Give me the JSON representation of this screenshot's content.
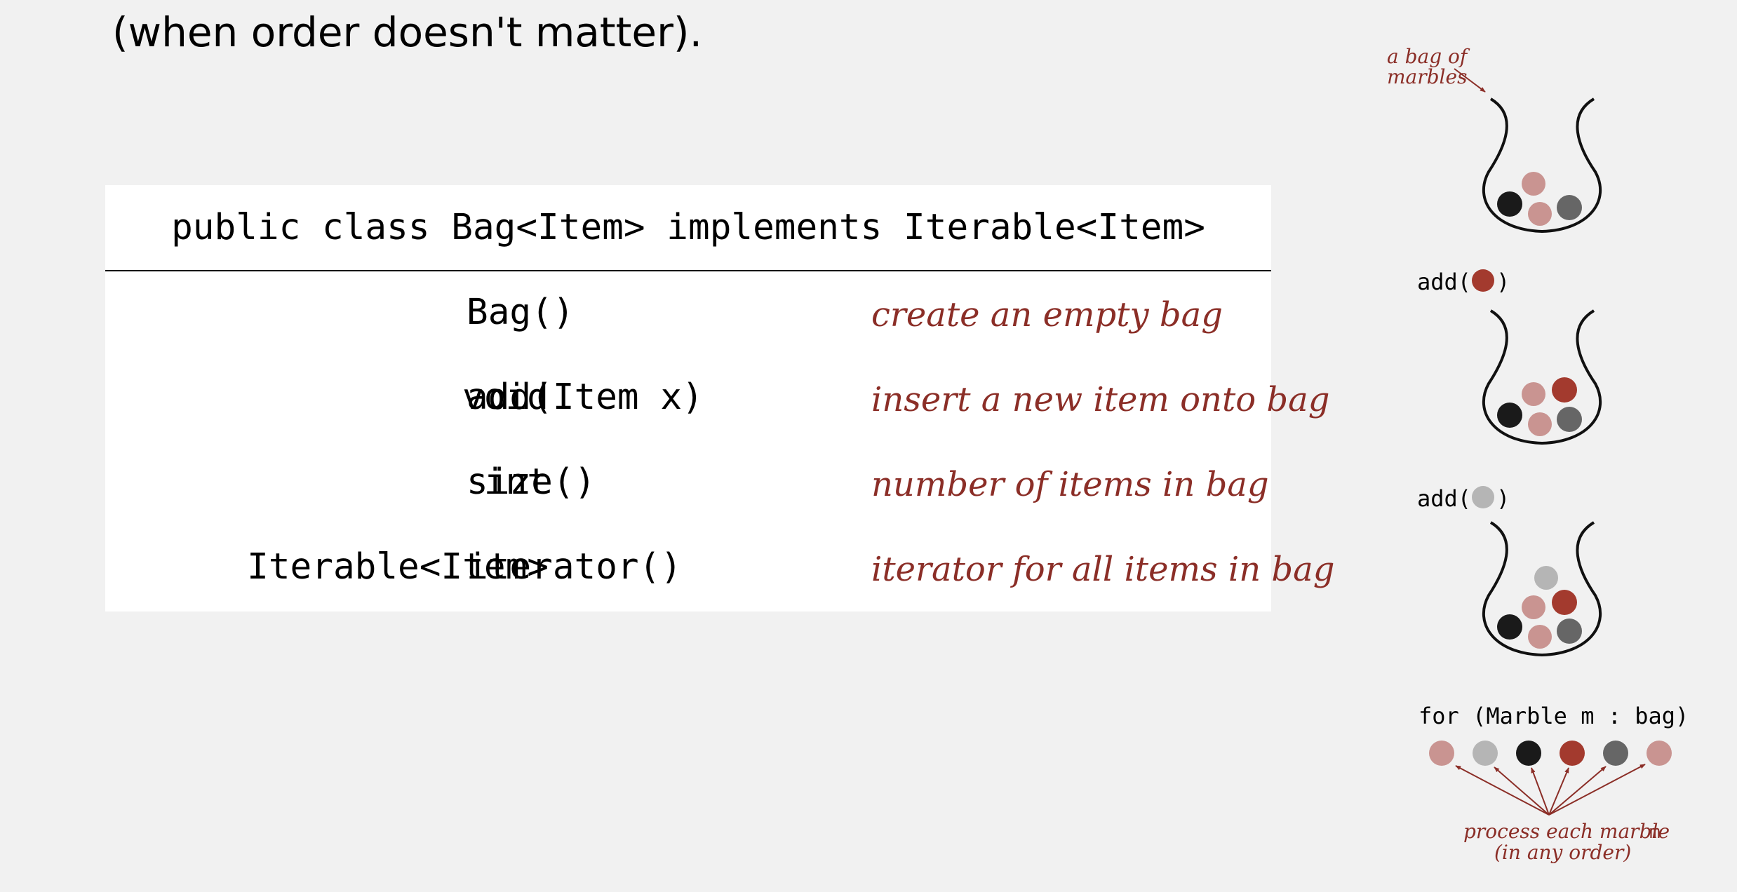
{
  "heading": "(when order doesn't matter).",
  "api": {
    "header": "public class Bag<Item> implements Iterable<Item>",
    "rows": [
      {
        "ret": "",
        "sig": "Bag()",
        "desc": "create an empty bag"
      },
      {
        "ret": "void",
        "sig": "add(Item x)",
        "desc": "insert a new item onto bag"
      },
      {
        "ret": "int",
        "sig": "size()",
        "desc": "number of items in bag"
      },
      {
        "ret": "Iterable<Item>",
        "sig": "iterator()",
        "desc": "iterator for all items in bag"
      }
    ]
  },
  "illustration": {
    "bag_label_line1": "a bag of",
    "bag_label_line2": "marbles",
    "add_prefix": "add(",
    "add_suffix": ")",
    "loop_label": "for (Marble m : bag)",
    "process_line1": "process each marble",
    "process_var": "m",
    "process_line2": "(in any order)"
  },
  "colors": {
    "accent": "#8b2e27",
    "marble_pink": "#c99491",
    "marble_black": "#1a1a1a",
    "marble_gray": "#666666",
    "marble_red": "#a33a2e",
    "marble_light": "#b5b5b5"
  }
}
